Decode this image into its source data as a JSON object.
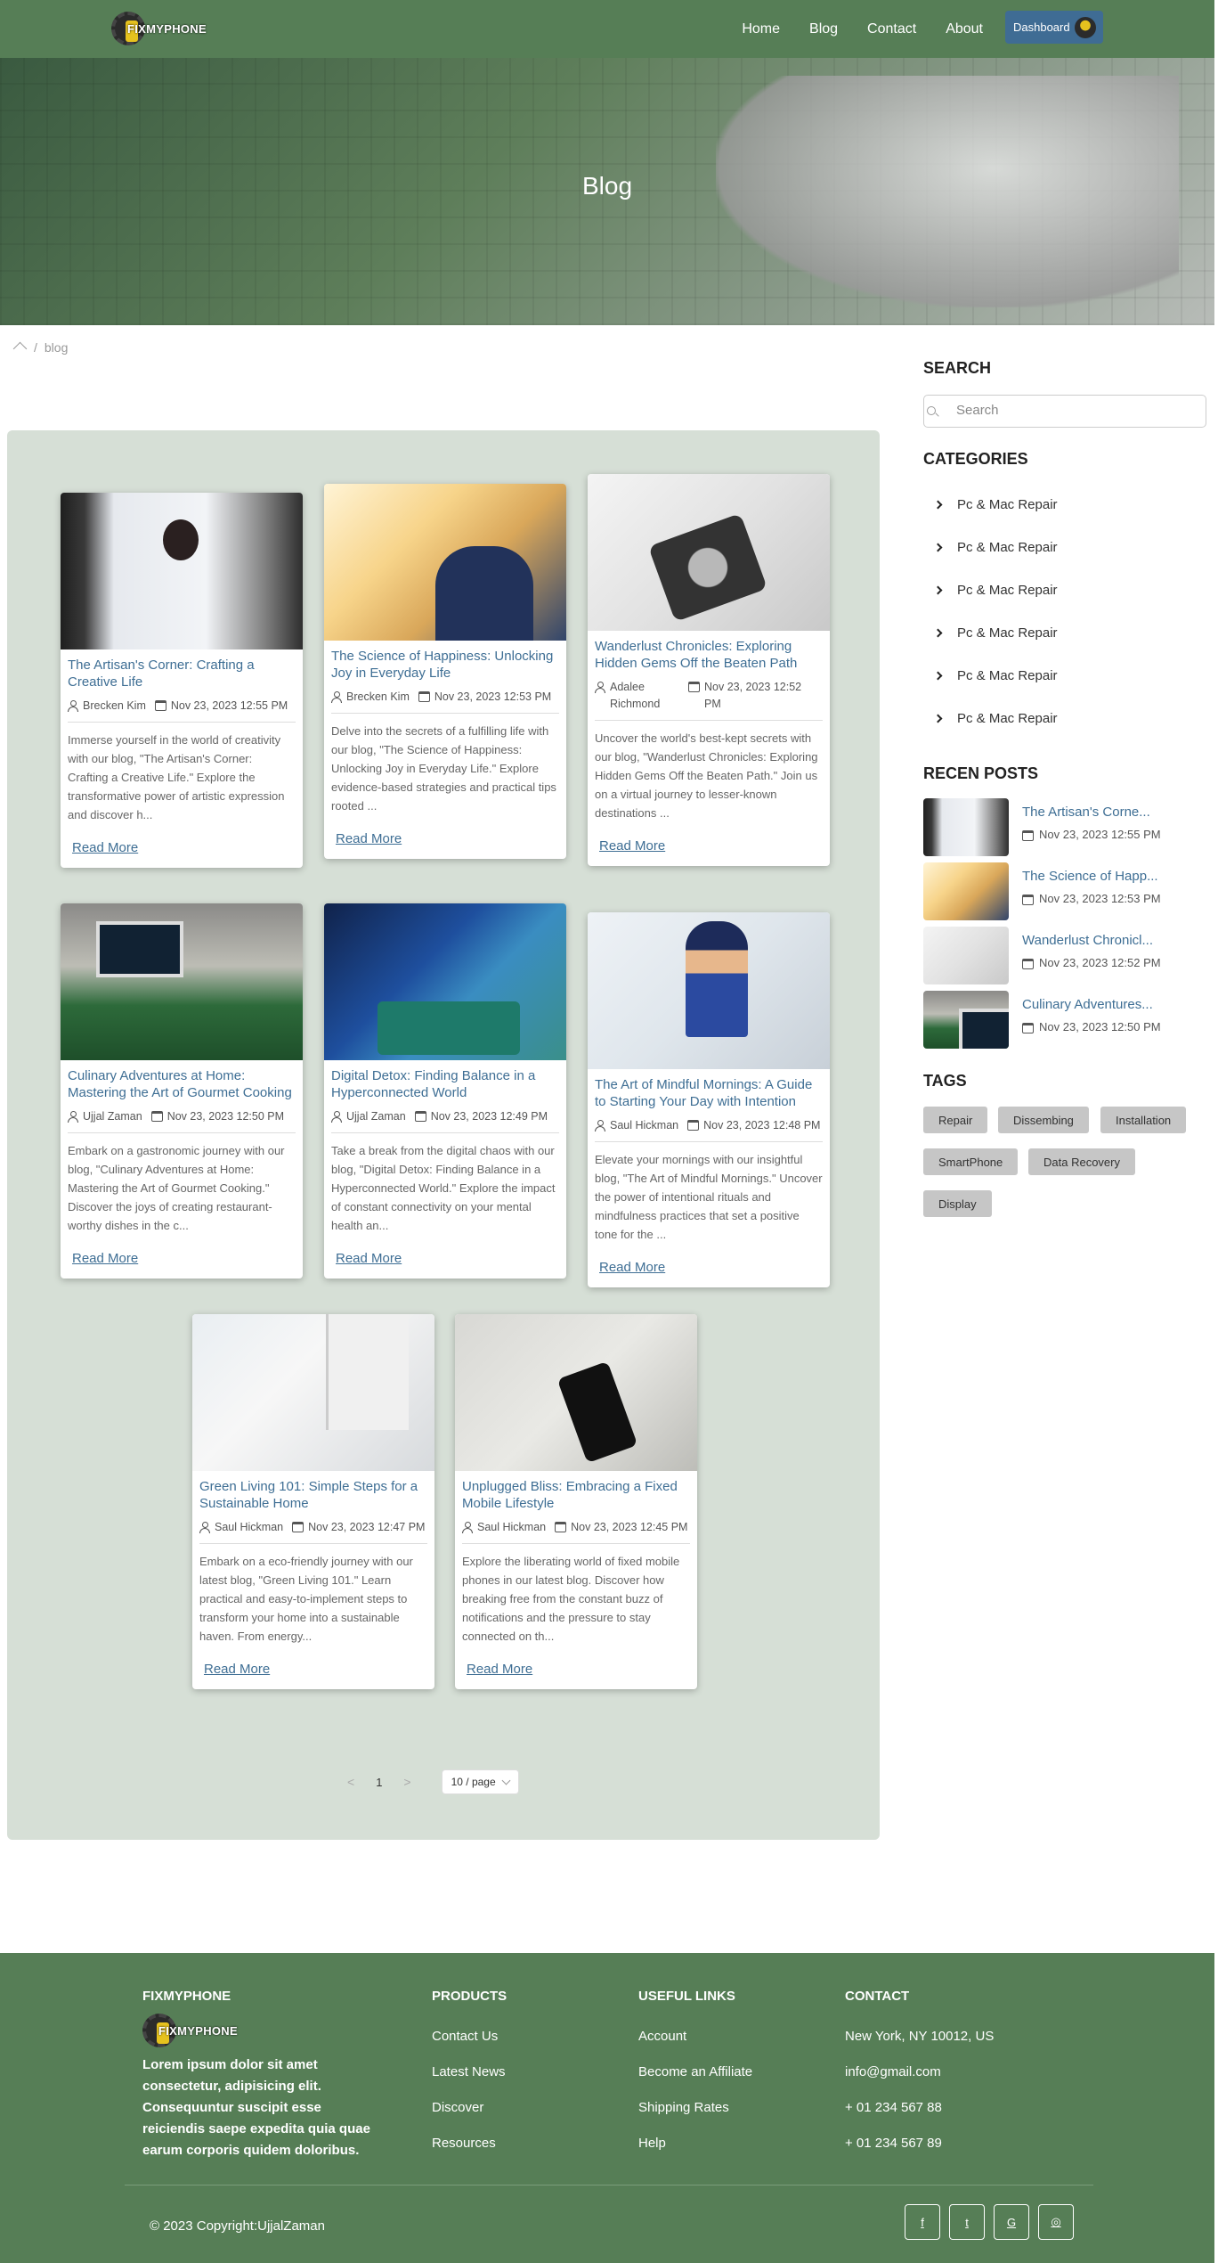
{
  "header": {
    "logo_text": "FIXMYPHONE",
    "nav": [
      "Home",
      "Blog",
      "Contact",
      "About"
    ],
    "dashboard_label": "Dashboard"
  },
  "hero": {
    "title": "Blog"
  },
  "breadcrumb": {
    "current": "blog",
    "separator": "/"
  },
  "posts": [
    {
      "title": "The Artisan's Corner: Crafting a Creative Life",
      "author": "Brecken Kim",
      "date": "Nov 23, 2023 12:55 PM",
      "excerpt": "Immerse yourself in the world of creativity with our blog, \"The Artisan's Corner: Crafting a Creative Life.\" Explore the transformative power of artistic expression and discover h...",
      "read_more": "Read More"
    },
    {
      "title": "The Science of Happiness: Unlocking Joy in Everyday Life",
      "author": "Brecken Kim",
      "date": "Nov 23, 2023 12:53 PM",
      "excerpt": "Delve into the secrets of a fulfilling life with our blog, \"The Science of Happiness: Unlocking Joy in Everyday Life.\" Explore evidence-based strategies and practical tips rooted ...",
      "read_more": "Read More"
    },
    {
      "title": "Wanderlust Chronicles: Exploring Hidden Gems Off the Beaten Path",
      "author": "Adalee Richmond",
      "date": "Nov 23, 2023 12:52 PM",
      "excerpt": "Uncover the world's best-kept secrets with our blog, \"Wanderlust Chronicles: Exploring Hidden Gems Off the Beaten Path.\" Join us on a virtual journey to lesser-known destinations ...",
      "read_more": "Read More"
    },
    {
      "title": "Culinary Adventures at Home: Mastering the Art of Gourmet Cooking",
      "author": "Ujjal Zaman",
      "date": "Nov 23, 2023 12:50 PM",
      "excerpt": "Embark on a gastronomic journey with our blog, \"Culinary Adventures at Home: Mastering the Art of Gourmet Cooking.\" Discover the joys of creating restaurant-worthy dishes in the c...",
      "read_more": "Read More"
    },
    {
      "title": "Digital Detox: Finding Balance in a Hyperconnected World",
      "author": "Ujjal Zaman",
      "date": "Nov 23, 2023 12:49 PM",
      "excerpt": "Take a break from the digital chaos with our blog, \"Digital Detox: Finding Balance in a Hyperconnected World.\" Explore the impact of constant connectivity on your mental health an...",
      "read_more": "Read More"
    },
    {
      "title": "The Art of Mindful Mornings: A Guide to Starting Your Day with Intention",
      "author": "Saul Hickman",
      "date": "Nov 23, 2023 12:48 PM",
      "excerpt": "Elevate your mornings with our insightful blog, \"The Art of Mindful Mornings.\" Uncover the power of intentional rituals and mindfulness practices that set a positive tone for the ...",
      "read_more": "Read More"
    },
    {
      "title": "Green Living 101: Simple Steps for a Sustainable Home",
      "author": "Saul Hickman",
      "date": "Nov 23, 2023 12:47 PM",
      "excerpt": "Embark on a eco-friendly journey with our latest blog, \"Green Living 101.\" Learn practical and easy-to-implement steps to transform your home into a sustainable haven. From energy...",
      "read_more": "Read More"
    },
    {
      "title": "Unplugged Bliss: Embracing a Fixed Mobile Lifestyle",
      "author": "Saul Hickman",
      "date": "Nov 23, 2023 12:45 PM",
      "excerpt": "Explore the liberating world of fixed mobile phones in our latest blog. Discover how breaking free from the constant buzz of notifications and the pressure to stay connected on th...",
      "read_more": "Read More"
    }
  ],
  "pagination": {
    "prev": "<",
    "current": "1",
    "next": ">",
    "page_size": "10 / page"
  },
  "sidebar": {
    "search_heading": "SEARCH",
    "search_placeholder": "Search",
    "categories_heading": "CATEGORIES",
    "categories": [
      "Pc & Mac Repair",
      "Pc & Mac Repair",
      "Pc & Mac Repair",
      "Pc & Mac Repair",
      "Pc & Mac Repair",
      "Pc & Mac Repair"
    ],
    "recent_heading": "RECEN POSTS",
    "recent": [
      {
        "title": "The Artisan's Corne...",
        "date": "Nov 23, 2023 12:55 PM"
      },
      {
        "title": "The Science of Happ...",
        "date": "Nov 23, 2023 12:53 PM"
      },
      {
        "title": "Wanderlust Chronicl...",
        "date": "Nov 23, 2023 12:52 PM"
      },
      {
        "title": "Culinary Adventures...",
        "date": "Nov 23, 2023 12:50 PM"
      }
    ],
    "tags_heading": "TAGS",
    "tags": [
      "Repair",
      "Dissembing",
      "Installation",
      "SmartPhone",
      "Data Recovery",
      "Display"
    ]
  },
  "footer": {
    "brand_heading": "FIXMYPHONE",
    "logo_text": "FIXMYPHONE",
    "about_text": "Lorem ipsum dolor sit amet consectetur, adipisicing elit. Consequuntur suscipit esse reiciendis saepe expedita quia quae earum corporis quidem doloribus.",
    "products_heading": "PRODUCTS",
    "products": [
      "Contact Us",
      "Latest News",
      "Discover",
      "Resources"
    ],
    "useful_heading": "USEFUL LINKS",
    "useful": [
      "Account",
      "Become an Affiliate",
      "Shipping Rates",
      "Help"
    ],
    "contact_heading": "CONTACT",
    "contact": [
      "New York, NY 10012, US",
      "info@gmail.com",
      "+ 01 234 567 88",
      "+ 01 234 567 89"
    ],
    "copyright": "© 2023 Copyright:UjjalZaman",
    "social": [
      {
        "icon": "facebook-icon",
        "glyph": "f"
      },
      {
        "icon": "twitter-icon",
        "glyph": "t"
      },
      {
        "icon": "google-icon",
        "glyph": "G"
      },
      {
        "icon": "instagram-icon",
        "glyph": "◎"
      }
    ]
  },
  "colors": {
    "header_bg": "#567e56",
    "link": "#3e6e94",
    "panel_bg": "#d6dfd6",
    "dashboard_bg": "#3f6c94"
  }
}
